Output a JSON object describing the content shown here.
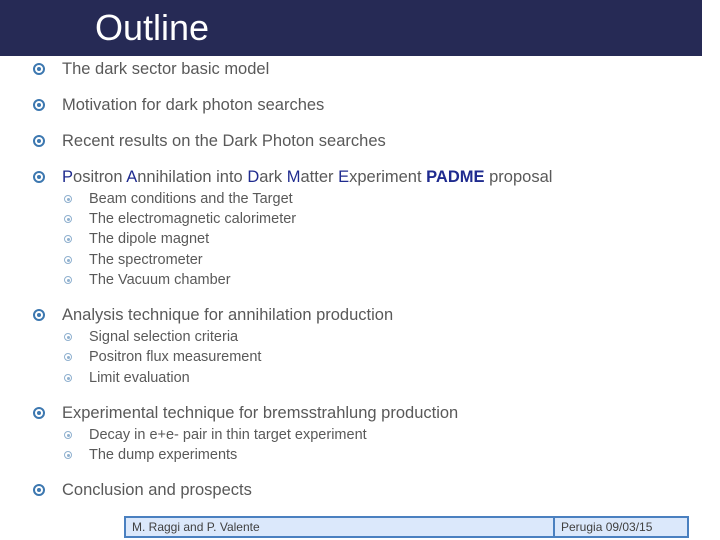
{
  "slide": {
    "title": "Outline",
    "items": [
      {
        "text": "The dark sector basic model"
      },
      {
        "text": "Motivation for dark photon searches"
      },
      {
        "text": "Recent results on the Dark Photon searches"
      },
      {
        "text_parts": [
          "P",
          "ositron ",
          "A",
          "nnihilation into ",
          "D",
          "ark ",
          "M",
          "atter ",
          "E",
          "xperiment ",
          "PADME",
          " proposal"
        ],
        "subitems": [
          "Beam conditions and the Target",
          "The electromagnetic calorimeter",
          "The dipole magnet",
          "The spectrometer",
          "The Vacuum chamber"
        ]
      },
      {
        "text": "Analysis technique for annihilation production",
        "subitems": [
          "Signal selection criteria",
          "Positron flux measurement",
          "Limit evaluation"
        ]
      },
      {
        "text": "Experimental technique for bremsstrahlung production",
        "subitems": [
          "Decay in e+e- pair in thin target experiment",
          "The dump experiments"
        ]
      },
      {
        "text": "Conclusion and prospects"
      }
    ]
  },
  "footer": {
    "authors": "M. Raggi and P. Valente",
    "place_date": "Perugia 09/03/15"
  },
  "colors": {
    "header_bg": "#262a55",
    "bullet": "#3d78b0",
    "highlight": "#1f2b8f",
    "footer_bg": "#dbe8fb",
    "footer_border": "#4a80c0"
  }
}
